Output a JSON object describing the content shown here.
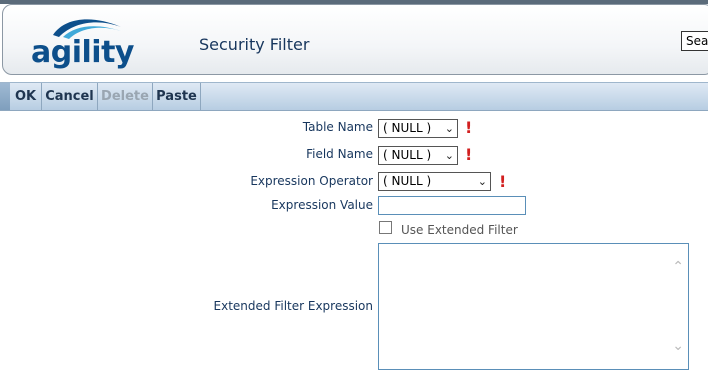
{
  "header": {
    "logo_text": "agility",
    "title": "Security Filter",
    "search_value": "Sea"
  },
  "toolbar": {
    "ok_label": "OK",
    "cancel_label": "Cancel",
    "delete_label": "Delete",
    "paste_label": "Paste"
  },
  "form": {
    "table_name": {
      "label": "Table Name",
      "value": "( NULL )"
    },
    "field_name": {
      "label": "Field Name",
      "value": "( NULL )"
    },
    "expression_operator": {
      "label": "Expression Operator",
      "value": "( NULL )"
    },
    "expression_value": {
      "label": "Expression Value",
      "value": ""
    },
    "use_extended_filter": {
      "label": "Use Extended Filter",
      "checked": false
    },
    "extended_filter_expression": {
      "label": "Extended Filter Expression",
      "value": ""
    }
  },
  "colors": {
    "label_text": "#17365d",
    "required_marker": "#d21f1f",
    "toolbar_top": "#dfe9f4",
    "toolbar_bottom": "#b7cde2"
  }
}
